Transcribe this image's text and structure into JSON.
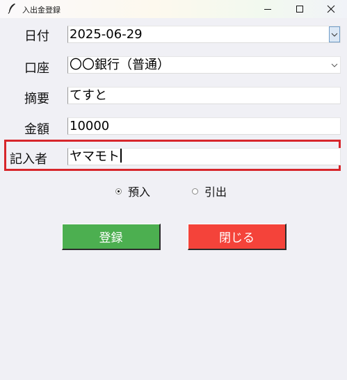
{
  "window": {
    "title": "入出金登録",
    "icon": "feather-icon",
    "controls": [
      "minimize-icon",
      "maximize-icon",
      "close-icon"
    ]
  },
  "form": {
    "date": {
      "label": "日付",
      "value": "2025-06-29"
    },
    "account": {
      "label": "口座",
      "value": "〇〇銀行（普通）"
    },
    "summary": {
      "label": "摘要",
      "value": "てすと"
    },
    "amount": {
      "label": "金額",
      "value": "10000"
    },
    "recorder": {
      "label": "記入者",
      "value": "ヤマモト"
    }
  },
  "type": {
    "options": [
      {
        "label": "預入",
        "selected": true
      },
      {
        "label": "引出",
        "selected": false
      }
    ]
  },
  "buttons": {
    "register": "登録",
    "close": "閉じる"
  },
  "colors": {
    "register_button": "#4caf50",
    "close_button": "#f4433a",
    "highlight_border": "#d7262b"
  }
}
